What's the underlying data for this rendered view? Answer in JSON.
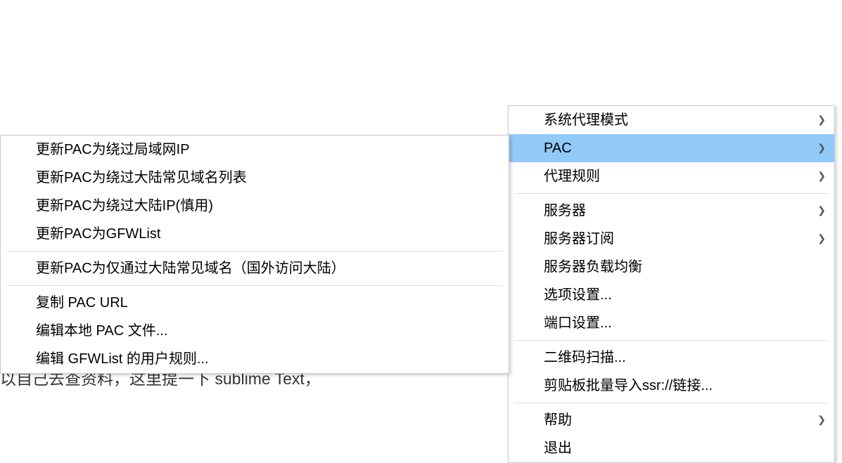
{
  "background": {
    "partial_text": "以自己去查资料，这里提一下 sublime Text，"
  },
  "main_menu": {
    "items": [
      {
        "label": "系统代理模式",
        "has_submenu": true,
        "highlighted": false
      },
      {
        "label": "PAC",
        "has_submenu": true,
        "highlighted": true
      },
      {
        "label": "代理规则",
        "has_submenu": true,
        "highlighted": false
      }
    ],
    "group2": [
      {
        "label": "服务器",
        "has_submenu": true,
        "highlighted": false
      },
      {
        "label": "服务器订阅",
        "has_submenu": true,
        "highlighted": false
      },
      {
        "label": "服务器负载均衡",
        "has_submenu": false,
        "highlighted": false
      },
      {
        "label": "选项设置...",
        "has_submenu": false,
        "highlighted": false
      },
      {
        "label": "端口设置...",
        "has_submenu": false,
        "highlighted": false
      }
    ],
    "group3": [
      {
        "label": "二维码扫描...",
        "has_submenu": false,
        "highlighted": false
      },
      {
        "label": "剪贴板批量导入ssr://链接...",
        "has_submenu": false,
        "highlighted": false
      }
    ],
    "group4": [
      {
        "label": "帮助",
        "has_submenu": true,
        "highlighted": false
      },
      {
        "label": "退出",
        "has_submenu": false,
        "highlighted": false
      }
    ]
  },
  "sub_menu": {
    "group1": [
      {
        "label": "更新PAC为绕过局域网IP"
      },
      {
        "label": "更新PAC为绕过大陆常见域名列表"
      },
      {
        "label": "更新PAC为绕过大陆IP(慎用)"
      },
      {
        "label": "更新PAC为GFWList"
      }
    ],
    "group2": [
      {
        "label": "更新PAC为仅通过大陆常见域名（国外访问大陆）"
      }
    ],
    "group3": [
      {
        "label": "复制 PAC URL"
      },
      {
        "label": "编辑本地 PAC 文件..."
      },
      {
        "label": "编辑 GFWList 的用户规则..."
      }
    ]
  }
}
